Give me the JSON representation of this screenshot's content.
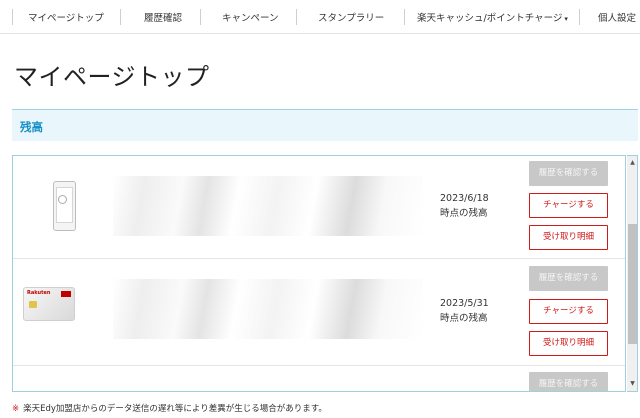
{
  "nav": {
    "items": [
      "マイページトップ",
      "履歴確認",
      "キャンペーン",
      "スタンプラリー",
      "楽天キャッシュ/ポイントチャージ",
      "個人設定"
    ],
    "dropdown_caret": "▾"
  },
  "page": {
    "title": "マイページトップ"
  },
  "balance_section": {
    "heading": "残高"
  },
  "cards": [
    {
      "kind": "mobile",
      "date": "2023/6/18",
      "date_caption": "時点の残高",
      "buttons": {
        "history": "履歴を確認する",
        "charge": "チャージする",
        "receipt": "受け取り明細"
      }
    },
    {
      "kind": "card",
      "card_brand": "Rakuten",
      "date": "2023/5/31",
      "date_caption": "時点の残高",
      "buttons": {
        "history": "履歴を確認する",
        "charge": "チャージする",
        "receipt": "受け取り明細"
      }
    },
    {
      "buttons": {
        "history": "履歴を確認する"
      }
    }
  ],
  "scrollbar": {
    "up": "▲",
    "down": "▼"
  },
  "note": {
    "mark": "※",
    "text": "楽天Edy加盟店からのデータ送信の遅れ等により差異が生じる場合があります。"
  },
  "colors": {
    "accent_blue": "#1a8fc6",
    "section_bg": "#e9f6fb",
    "button_red": "#d11919",
    "disabled_gray": "#c8c8c8"
  }
}
